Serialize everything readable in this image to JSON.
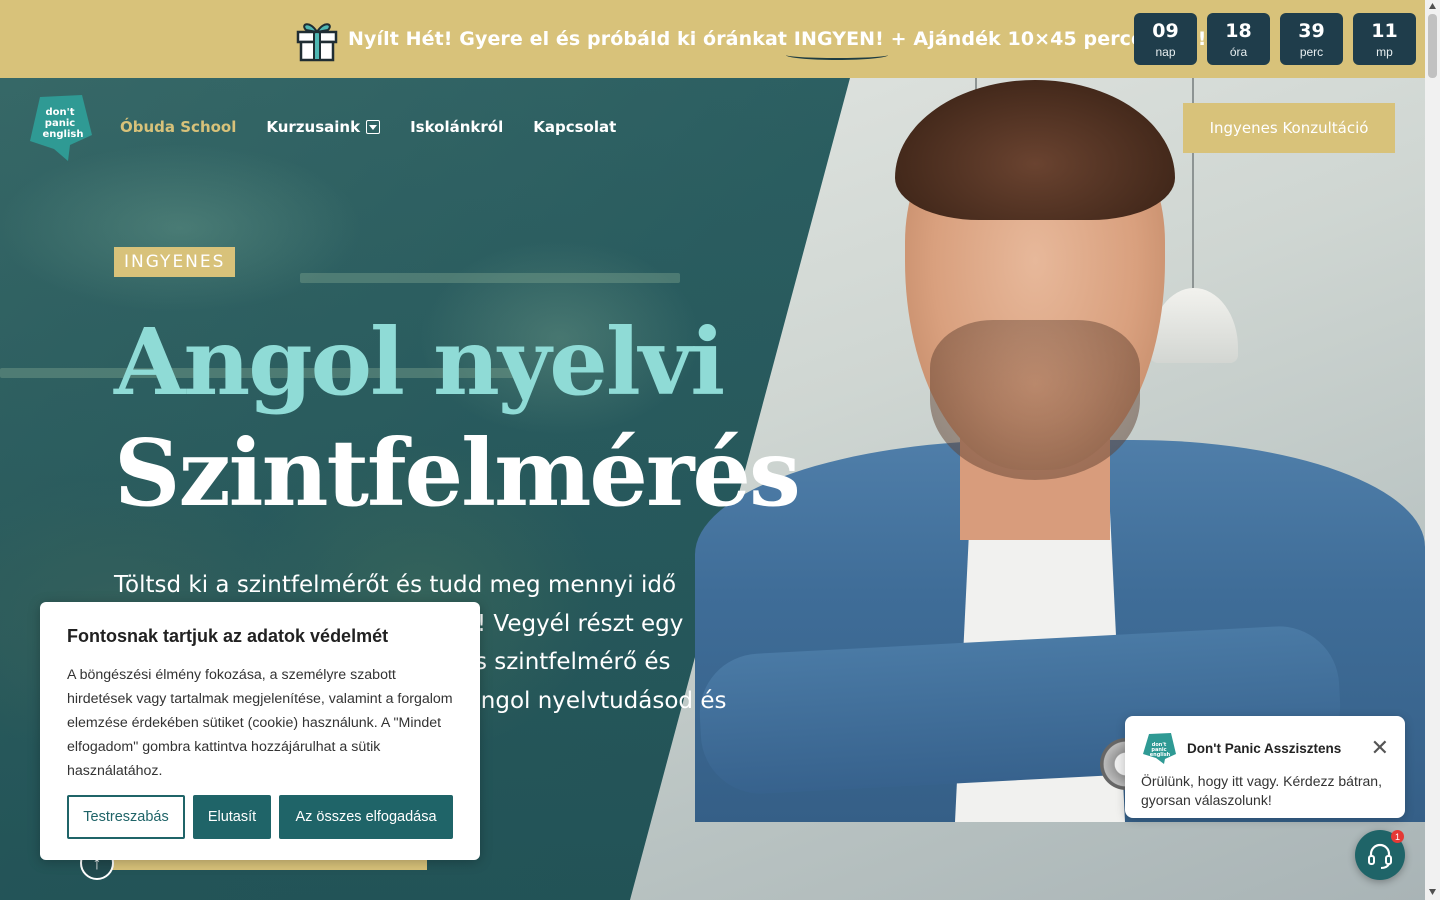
{
  "promo": {
    "text_before": "Nyílt Hét! Gyere el és próbáld ki óránkat ",
    "highlight": "INGYEN!",
    "text_after": " + Ajándék 10×45 perces óra!",
    "countdown": [
      {
        "value": "09",
        "unit": "nap"
      },
      {
        "value": "18",
        "unit": "óra"
      },
      {
        "value": "39",
        "unit": "perc"
      },
      {
        "value": "11",
        "unit": "mp"
      }
    ]
  },
  "logo": {
    "lines": [
      "don't",
      "panic",
      "english"
    ]
  },
  "nav": {
    "items": [
      {
        "label": "Óbuda School",
        "active": true
      },
      {
        "label": "Kurzusaink",
        "has_dropdown": true
      },
      {
        "label": "Iskolánkról"
      },
      {
        "label": "Kapcsolat"
      }
    ],
    "cta": "Ingyenes Konzultáció"
  },
  "hero": {
    "badge": "INGYENES",
    "title_line1": "Angol nyelvi",
    "title_line2": "Szintfelmérés",
    "lead": "Töltsd ki a szintfelmérőt és tudd meg mennyi idő alatt érheted el a kitűzött célod! Vegyél részt egy ingyenes online vagy személyes szintfelmérő és tanácsadáson. Ismerd meg az angol nyelvtudásod és hogyan tanulhatsz meg"
  },
  "cookie": {
    "title": "Fontosnak tartjuk az adatok védelmét",
    "body": "A böngészési élmény fokozása, a személyre szabott hirdetések vagy tartalmak megjelenítése, valamint a forgalom elemzése érdekében sütiket (cookie) használunk. A \"Mindet elfogadom\" gombra kattintva hozzájárulhat a sütik használatához.",
    "customize": "Testreszabás",
    "reject": "Elutasít",
    "accept": "Az összes elfogadása"
  },
  "chat": {
    "title": "Don't Panic Asszisztens",
    "message": "Örülünk, hogy itt vagy. Kérdezz bátran, gyorsan válaszolunk!",
    "badge_count": "1"
  },
  "colors": {
    "gold": "#d8c27a",
    "teal_dark": "#1f6468",
    "navy": "#1f3d4b",
    "title_cyan": "#8fdbd6"
  }
}
